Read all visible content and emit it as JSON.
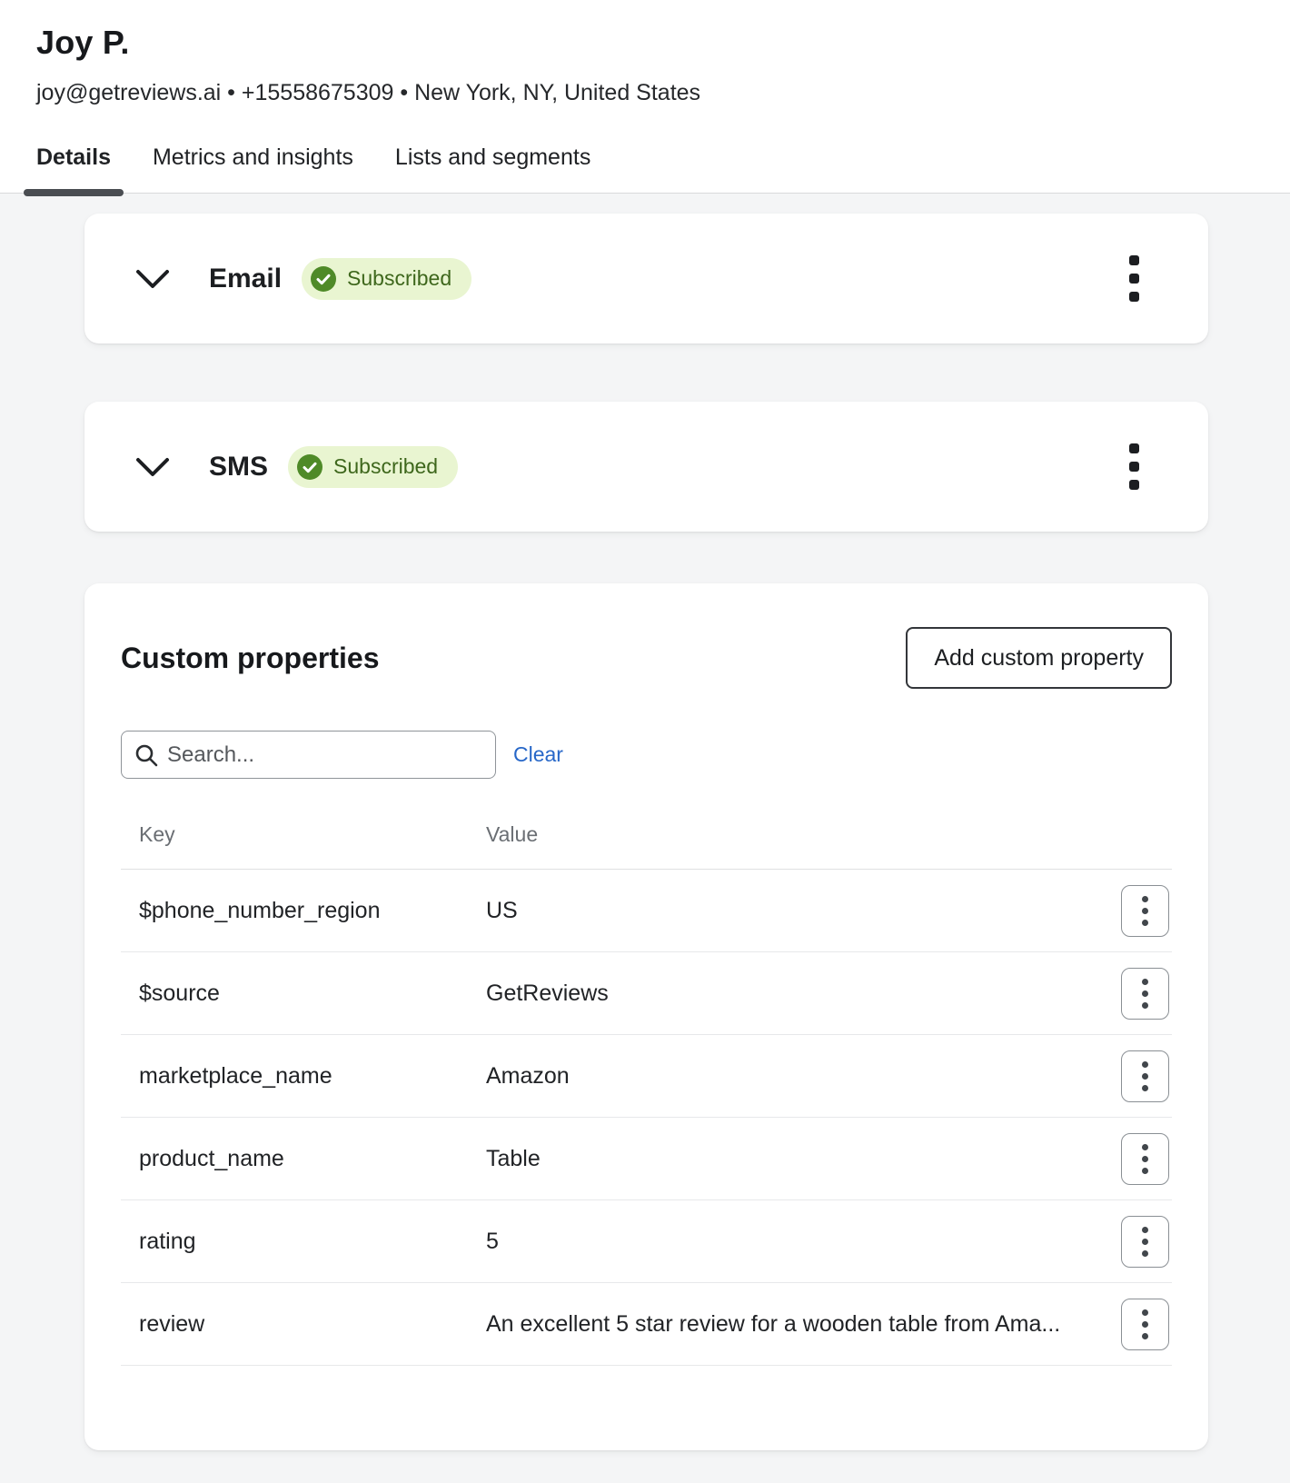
{
  "header": {
    "name": "Joy P.",
    "contact_line": "joy@getreviews.ai • +15558675309 • New York, NY, United States",
    "tabs": [
      {
        "label": "Details",
        "active": true
      },
      {
        "label": "Metrics and insights",
        "active": false
      },
      {
        "label": "Lists and segments",
        "active": false
      }
    ]
  },
  "channels": [
    {
      "title": "Email",
      "status": "Subscribed"
    },
    {
      "title": "SMS",
      "status": "Subscribed"
    }
  ],
  "custom_properties": {
    "title": "Custom properties",
    "add_button_label": "Add custom property",
    "search_placeholder": "Search...",
    "clear_label": "Clear",
    "columns": {
      "key": "Key",
      "value": "Value"
    },
    "rows": [
      {
        "key": "$phone_number_region",
        "value": "US"
      },
      {
        "key": "$source",
        "value": "GetReviews"
      },
      {
        "key": "marketplace_name",
        "value": "Amazon"
      },
      {
        "key": "product_name",
        "value": "Table"
      },
      {
        "key": "rating",
        "value": "5"
      },
      {
        "key": "review",
        "value": "An excellent 5 star review for a wooden table from Ama..."
      }
    ]
  },
  "colors": {
    "page_background": "#f4f5f6",
    "card_background": "#ffffff",
    "badge_background": "#e9f5d1",
    "badge_text": "#3e671c",
    "badge_check_green": "#4f8a28",
    "active_tab_underline": "#4a4d52",
    "link_blue": "#2767c8"
  }
}
